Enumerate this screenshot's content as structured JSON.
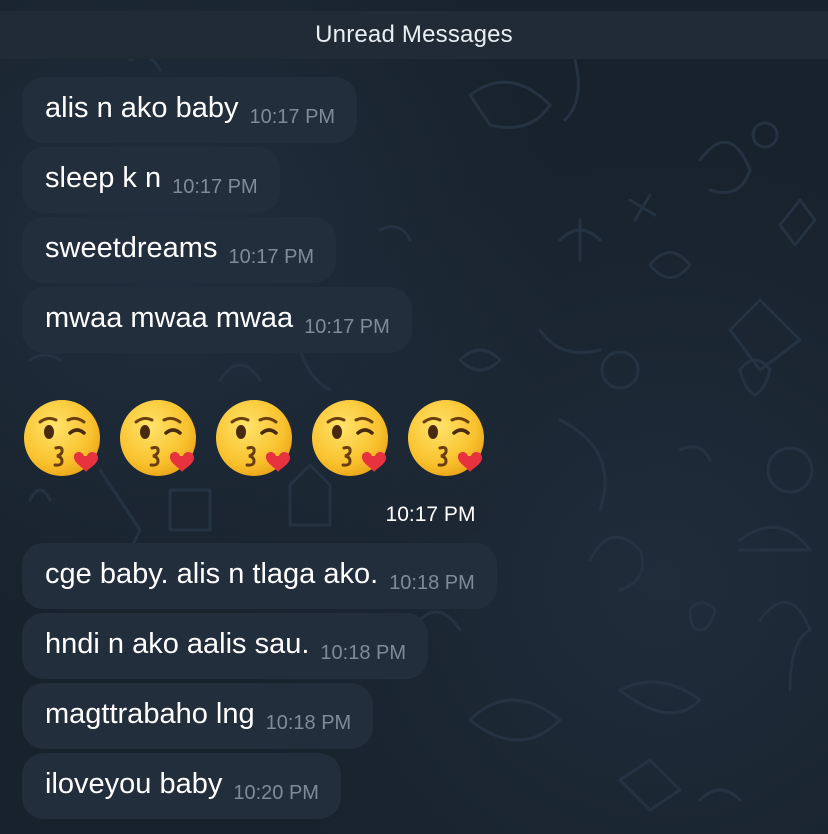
{
  "header": {
    "unread_label": "Unread Messages"
  },
  "messages_before": [
    {
      "text": "alis n ako baby",
      "time": "10:17 PM"
    },
    {
      "text": "sleep k n",
      "time": "10:17 PM"
    },
    {
      "text": "sweetdreams",
      "time": "10:17 PM"
    },
    {
      "text": "mwaa mwaa mwaa",
      "time": "10:17 PM"
    }
  ],
  "emoji_message": {
    "emoji": "kissing-face-with-heart-icon",
    "count": 5,
    "time": "10:17 PM"
  },
  "messages_after": [
    {
      "text": "cge baby. alis n tlaga ako.",
      "time": "10:18 PM"
    },
    {
      "text": "hndi n ako aalis sau.",
      "time": "10:18 PM"
    },
    {
      "text": "magttrabaho lng",
      "time": "10:18 PM"
    },
    {
      "text": "iloveyou baby",
      "time": "10:20 PM"
    }
  ],
  "colors": {
    "background": "#17212b",
    "bubble": "#232e3c",
    "unread_bar": "#202b36",
    "time_text": "#7f8b98"
  }
}
